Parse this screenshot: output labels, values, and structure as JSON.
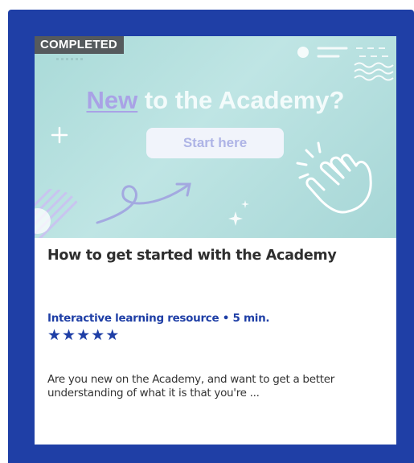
{
  "badge": "COMPLETED",
  "banner": {
    "headline_accent": "New",
    "headline_rest": " to the Academy?",
    "button_label": "Start here"
  },
  "card": {
    "title": "How to get started with the Academy",
    "meta": "Interactive learning resource • 5 min.",
    "rating": 5,
    "stars": "★★★★★",
    "description": "Are you new on the Academy, and want to get a better understanding of what it is that you're ..."
  },
  "colors": {
    "frame": "#1f3fa6",
    "banner": "#b3dfdd",
    "accent": "#1f3fa6"
  }
}
